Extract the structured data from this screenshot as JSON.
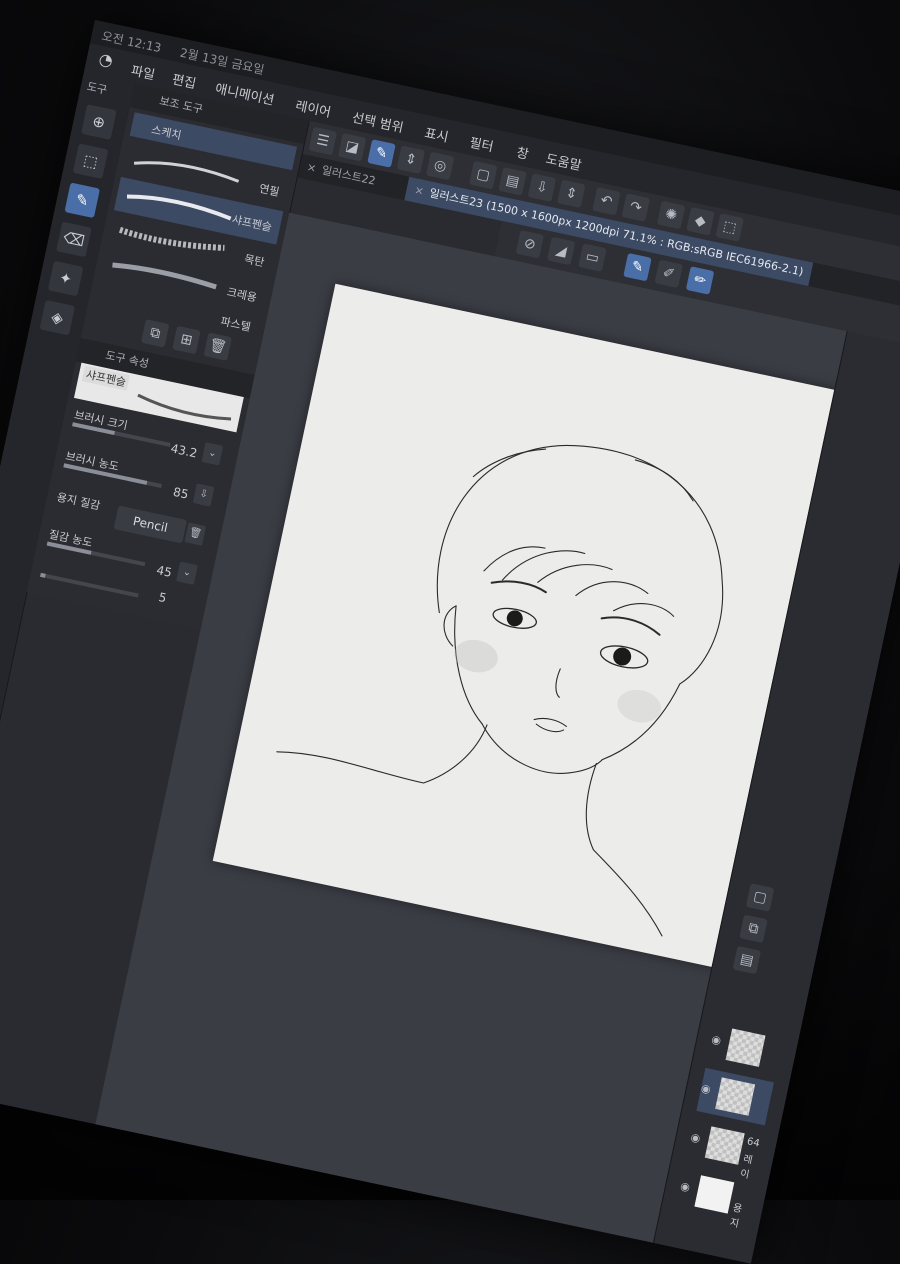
{
  "status": {
    "time": "오전 12:13",
    "date": "2월 13일 금요일"
  },
  "menu": [
    "파일",
    "편집",
    "애니메이션",
    "레이어",
    "선택 범위",
    "표시",
    "필터",
    "창",
    "도움말"
  ],
  "tools_panel_title": "도구",
  "subtool": {
    "title": "보조 도구",
    "group": "스케치",
    "items": [
      "연필",
      "샤프펜슬",
      "목탄",
      "크레용"
    ],
    "selected": "샤프펜슬",
    "footer_label": "파스텔"
  },
  "tool_property": {
    "title": "도구 속성",
    "tool_name": "샤프펜슬",
    "brush_size_label": "브러시 크기",
    "brush_size_value": "43.2",
    "brush_density_label": "브러시 농도",
    "brush_density_value": "85",
    "texture_label": "용지 질감",
    "texture_button": "Pencil",
    "texture_density_label": "질감 농도",
    "texture_density_value": "45",
    "stabilization_value": "5"
  },
  "tabs": [
    {
      "label": "일러스트22",
      "active": false
    },
    {
      "label": "일러스트23 (1500 x 1600px 1200dpi 71.1% : RGB:sRGB IEC61966-2.1)",
      "active": true
    }
  ],
  "layers": {
    "opacity_label": "64",
    "layer_name_short": "레이",
    "paper_label": "용지"
  },
  "colors": {
    "accent": "#4a6fa8",
    "paper": "#ececea",
    "canvas_bg": "#3b3d45"
  }
}
